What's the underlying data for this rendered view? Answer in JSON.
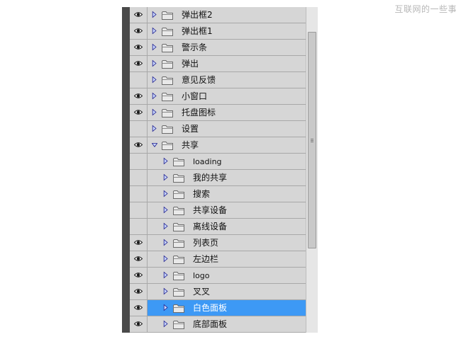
{
  "watermark": "互联网的一些事",
  "colors": {
    "selected_row": "#3d99f5",
    "panel_bg": "#d6d6d6",
    "left_bar": "#4a4a4a"
  },
  "layers": [
    {
      "label": "弹出框2",
      "visible": true,
      "depth": 0,
      "expanded": false,
      "selected": false
    },
    {
      "label": "弹出框1",
      "visible": true,
      "depth": 0,
      "expanded": false,
      "selected": false
    },
    {
      "label": "警示条",
      "visible": true,
      "depth": 0,
      "expanded": false,
      "selected": false
    },
    {
      "label": "弹出",
      "visible": true,
      "depth": 0,
      "expanded": false,
      "selected": false
    },
    {
      "label": "意见反馈",
      "visible": false,
      "depth": 0,
      "expanded": false,
      "selected": false
    },
    {
      "label": "小窗口",
      "visible": true,
      "depth": 0,
      "expanded": false,
      "selected": false
    },
    {
      "label": "托盘图标",
      "visible": true,
      "depth": 0,
      "expanded": false,
      "selected": false
    },
    {
      "label": "设置",
      "visible": false,
      "depth": 0,
      "expanded": false,
      "selected": false
    },
    {
      "label": "共享",
      "visible": true,
      "depth": 0,
      "expanded": true,
      "selected": false
    },
    {
      "label": "loading",
      "visible": false,
      "depth": 1,
      "expanded": false,
      "selected": false
    },
    {
      "label": "我的共享",
      "visible": false,
      "depth": 1,
      "expanded": false,
      "selected": false
    },
    {
      "label": "搜索",
      "visible": false,
      "depth": 1,
      "expanded": false,
      "selected": false
    },
    {
      "label": "共享设备",
      "visible": false,
      "depth": 1,
      "expanded": false,
      "selected": false
    },
    {
      "label": "离线设备",
      "visible": false,
      "depth": 1,
      "expanded": false,
      "selected": false
    },
    {
      "label": "列表页",
      "visible": true,
      "depth": 1,
      "expanded": false,
      "selected": false
    },
    {
      "label": "左边栏",
      "visible": true,
      "depth": 1,
      "expanded": false,
      "selected": false
    },
    {
      "label": "logo",
      "visible": true,
      "depth": 1,
      "expanded": false,
      "selected": false
    },
    {
      "label": "叉叉",
      "visible": true,
      "depth": 1,
      "expanded": false,
      "selected": false
    },
    {
      "label": "白色面板",
      "visible": true,
      "depth": 1,
      "expanded": false,
      "selected": true
    },
    {
      "label": "底部面板",
      "visible": true,
      "depth": 1,
      "expanded": false,
      "selected": false
    }
  ],
  "icons": {
    "eye": "eye-icon",
    "expand": "disclosure-triangle-icon",
    "folder": "folder-icon"
  }
}
